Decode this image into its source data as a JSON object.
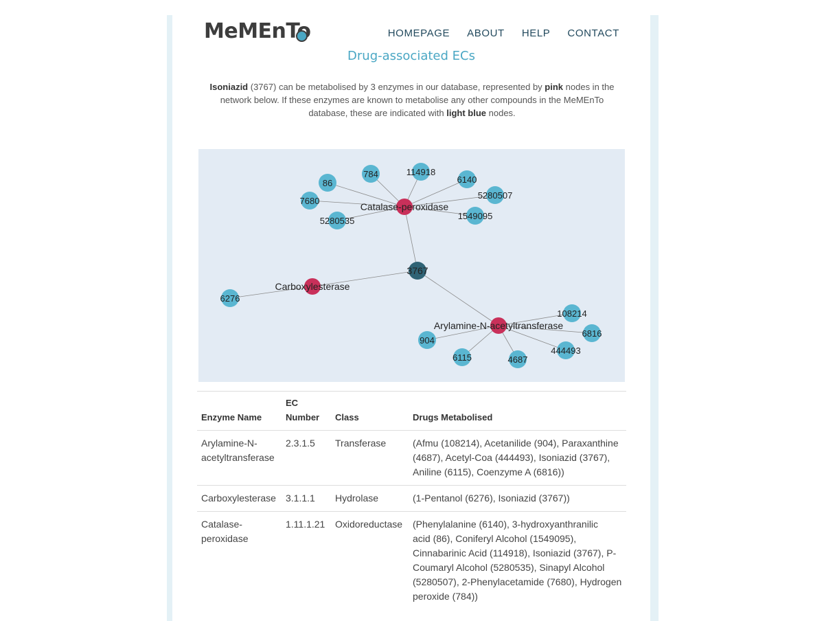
{
  "header": {
    "logo_text": "MeMEnTo",
    "nav": [
      "HOMEPAGE",
      "ABOUT",
      "HELP",
      "CONTACT"
    ]
  },
  "page_title": "Drug-associated ECs",
  "intro": {
    "drug_name": "Isoniazid",
    "drug_id_text": "(3767)",
    "text_1": " can be metabolised by 3 enzymes in our database, represented by ",
    "pink_word": "pink",
    "text_2": " nodes in the network below. If these enzymes are known to metabolise any other compounds in the MeMEnTo database, these are indicated with ",
    "light_blue_word": "light blue",
    "text_3": " nodes."
  },
  "colors": {
    "accent": "#4aa7c4",
    "enzyme_node": "#c9305a",
    "drug_node": "#5ab6d1",
    "query_node": "#2f6375",
    "graph_background": "#e3ebf4",
    "edge": "#8a8a8a"
  },
  "network": {
    "query": "3767",
    "enzymes": [
      {
        "label": "Catalase-peroxidase",
        "compounds": [
          "86",
          "784",
          "114918",
          "6140",
          "5280507",
          "7680",
          "5280535",
          "1549095"
        ]
      },
      {
        "label": "Carboxylesterase",
        "compounds": [
          "6276"
        ]
      },
      {
        "label": "Arylamine-N-acetyltransferase",
        "compounds": [
          "108214",
          "6816",
          "444493",
          "4687",
          "6115",
          "904"
        ]
      }
    ]
  },
  "table": {
    "headers": {
      "name": "Enzyme Name",
      "ec_line1": "EC",
      "ec_line2": "Number",
      "class": "Class",
      "drugs": "Drugs Metabolised"
    },
    "rows": [
      {
        "name_lines": [
          "Arylamine-N-",
          "acetyltransferase"
        ],
        "ec": "2.3.1.5",
        "class": "Transferase",
        "drugs_lines": [
          "(Afmu (108214), Acetanilide (904), Paraxanthine",
          "(4687), Acetyl-Coa (444493), Isoniazid (3767),",
          "Aniline (6115), Coenzyme A (6816))"
        ]
      },
      {
        "name_lines": [
          "Carboxylesterase"
        ],
        "ec": "3.1.1.1",
        "class": "Hydrolase",
        "drugs_lines": [
          "(1-Pentanol (6276), Isoniazid (3767))"
        ]
      },
      {
        "name_lines": [
          "Catalase-",
          "peroxidase"
        ],
        "ec": "1.11.1.21",
        "class": "Oxidoreductase",
        "drugs_lines": [
          "(Phenylalanine (6140), 3-hydroxyanthranilic",
          "acid (86), Coniferyl Alcohol (1549095),",
          "Cinnabarinic Acid (114918), Isoniazid (3767), P-",
          "Coumaryl Alcohol (5280535), Sinapyl Alcohol",
          "(5280507), 2-Phenylacetamide (7680), Hydrogen",
          "peroxide (784))"
        ]
      }
    ]
  }
}
